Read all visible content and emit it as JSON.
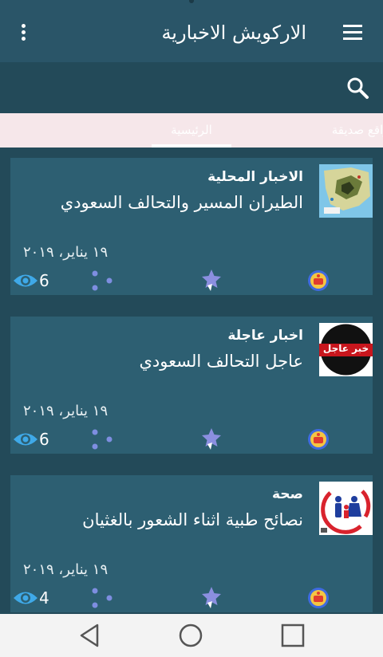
{
  "app": {
    "title": "الاركويش الاخبارية"
  },
  "tabs": [
    {
      "label": "الرئيسية",
      "active": true
    },
    {
      "label": "مواقع صديقة",
      "active": false
    }
  ],
  "colors": {
    "background": "#234a59",
    "topbar": "#2a5568",
    "card": "#2d5f72",
    "tabs_bg": "#f6e7ea",
    "star": "#8b8fe0",
    "eye": "#3fa9e8",
    "navbar": "#f3f3f3"
  },
  "icons": {
    "menu": "hamburger-icon",
    "more": "overflow-dots-icon",
    "search": "search-icon",
    "views": "eye-icon",
    "share": "share-dots-icon",
    "favorite": "star-icon",
    "badge": "app-badge-icon"
  },
  "articles": [
    {
      "category": "الاخبار المحلية",
      "headline": "الطيران المسير والتحالف السعودي",
      "date": "١٩ يناير، ٢٠١٩",
      "views": "6",
      "thumbnail": "map-thumbnail"
    },
    {
      "category": "اخبار عاجلة",
      "headline": "عاجل التحالف السعودي",
      "date": "١٩ يناير، ٢٠١٩",
      "views": "6",
      "thumbnail": "breaking-news-thumbnail",
      "thumbnail_text": "خبر عاجل"
    },
    {
      "category": "صحة",
      "headline": "نصائح طبية اثناء الشعور بالغثيان",
      "date": "١٩ يناير، ٢٠١٩",
      "views": "4",
      "thumbnail": "family-health-thumbnail"
    }
  ],
  "system_nav": [
    "back",
    "home",
    "recents"
  ]
}
